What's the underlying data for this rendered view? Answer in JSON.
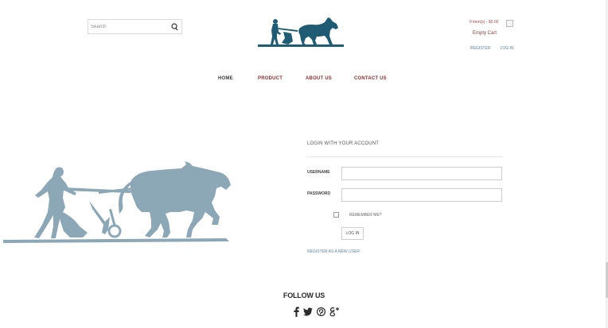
{
  "header": {
    "search": {
      "placeholder": "Search",
      "value": ""
    },
    "cart": {
      "items_text": "0 item(s) - $0.00",
      "empty_text": "Empty Cart"
    },
    "account": {
      "register_label": "REGISTER",
      "login_label": "LOG IN"
    }
  },
  "nav": {
    "home": "HOME",
    "product": "PRODUCT",
    "about": "ABOUT US",
    "contact": "CONTACT US"
  },
  "login": {
    "title": "LOGIN WITH YOUR ACCOUNT",
    "username_label": "USERNAME",
    "password_label": "PASSWORD",
    "username_value": "",
    "password_value": "",
    "remember_label": "REMEMBER ME?",
    "button_label": "LOG IN",
    "register_link": "REGISTER AS A NEW USER"
  },
  "footer": {
    "follow_title": "FOLLOW US",
    "social_icons": [
      "facebook-icon",
      "twitter-icon",
      "pinterest-icon",
      "google-plus-icon"
    ]
  },
  "colors": {
    "logo_blue": "#1f5c74",
    "hero_blue": "#8ca7b6",
    "nav_accent": "#8b2f2f",
    "link_blue": "#5a86a8"
  }
}
